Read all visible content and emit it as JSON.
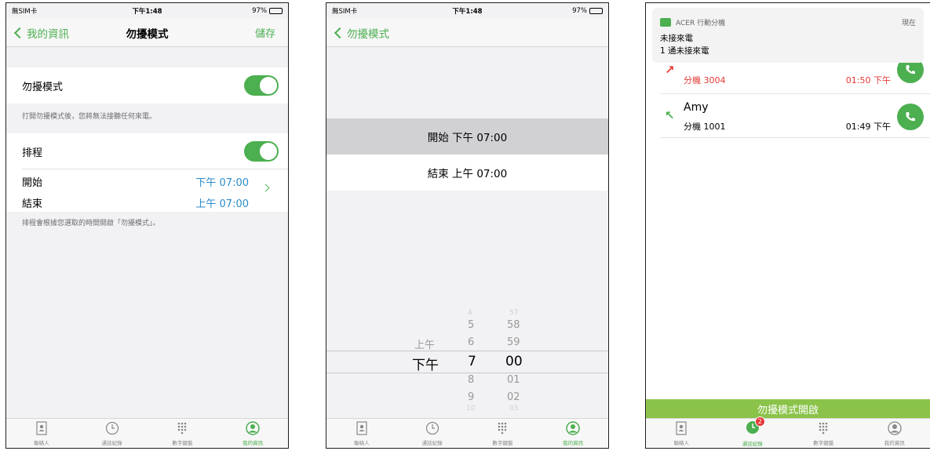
{
  "status": {
    "carrier": "無SIM卡",
    "time": "下午1:48",
    "battery": "97%"
  },
  "screen1": {
    "back_label": "我的資訊",
    "title": "勿擾模式",
    "save_label": "儲存",
    "dnd_label": "勿擾模式",
    "dnd_on": true,
    "dnd_note": "打開勿擾模式後，您將無法接聽任何來電。",
    "schedule_label": "排程",
    "schedule_on": true,
    "start_label": "開始",
    "start_value": "下午 07:00",
    "end_label": "結束",
    "end_value": "上午 07:00",
    "schedule_note": "排程會根據您選取的時間開啟「勿擾模式」。"
  },
  "screen2": {
    "back_label": "勿擾模式",
    "start_row": "開始 下午 07:00",
    "end_row": "結束 上午 07:00",
    "picker": {
      "ampm": [
        "上午",
        "下午"
      ],
      "hours": [
        "4",
        "5",
        "6",
        "7",
        "8",
        "9",
        "10"
      ],
      "minutes": [
        "57",
        "58",
        "59",
        "00",
        "01",
        "02",
        "03"
      ],
      "selected_ampm": "下午",
      "selected_hour": "7",
      "selected_minute": "00"
    }
  },
  "screen3": {
    "notification": {
      "app": "ACER 行動分機",
      "when": "現在",
      "title": "未接來電",
      "body": "1 通未接來電"
    },
    "calls": [
      {
        "name": "",
        "ext": "分機 3004",
        "time": "01:50 下午",
        "missed": true
      },
      {
        "name": "Amy",
        "ext": "分機 1001",
        "time": "01:49 下午",
        "missed": false
      }
    ],
    "dnd_banner": "勿擾模式開啟",
    "history_badge": "2"
  },
  "tabs": [
    {
      "label": "聯絡人",
      "icon": "contacts-icon"
    },
    {
      "label": "通話紀錄",
      "icon": "clock-icon"
    },
    {
      "label": "數字鍵盤",
      "icon": "keypad-icon"
    },
    {
      "label": "我的資訊",
      "icon": "person-icon"
    }
  ],
  "colors": {
    "accent": "#4caf50",
    "link_blue": "#2b8ccc",
    "missed_red": "#e53935",
    "banner_green": "#8bc34a"
  }
}
